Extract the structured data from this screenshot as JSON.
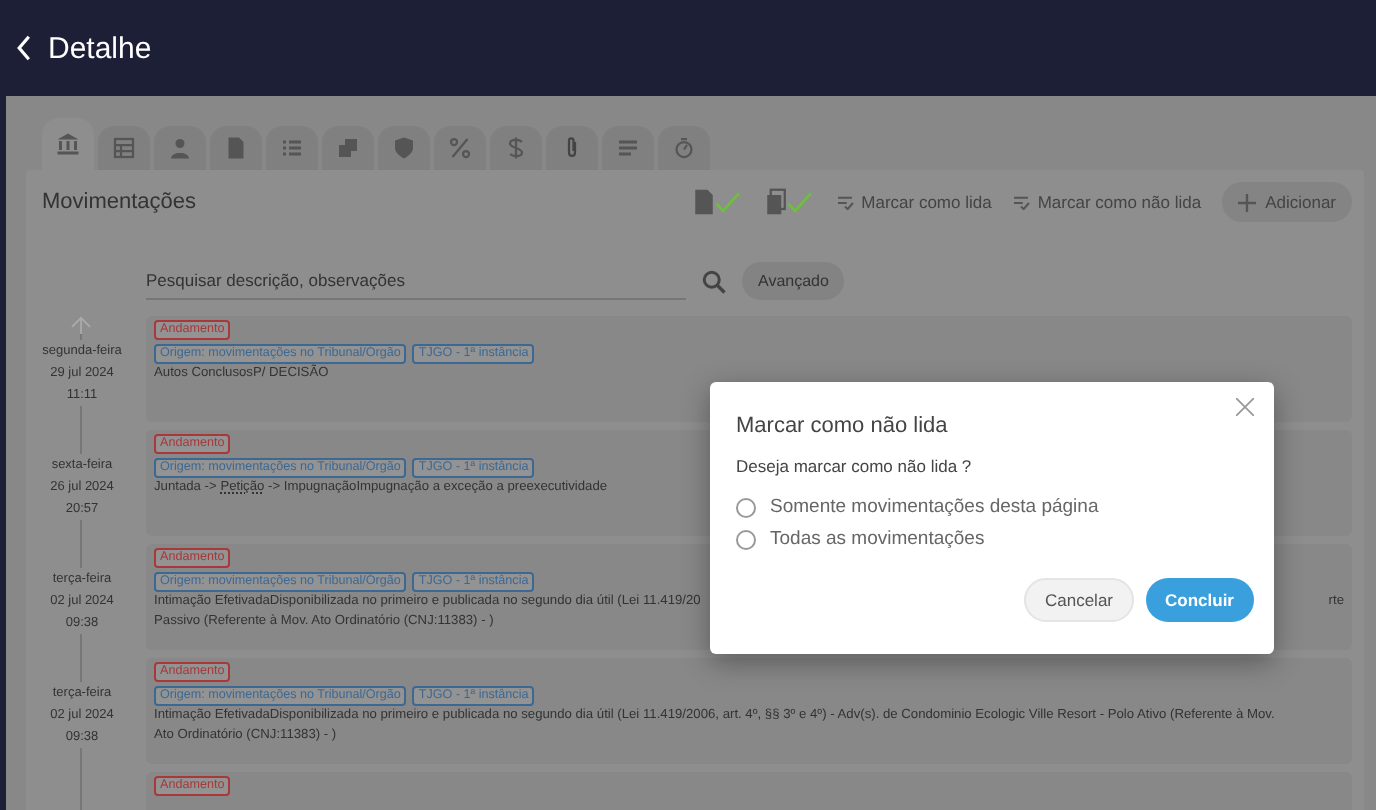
{
  "header": {
    "title": "Detalhe"
  },
  "tabs": [
    {
      "kind": "bank",
      "selected": true
    },
    {
      "kind": "table",
      "selected": false
    },
    {
      "kind": "person",
      "selected": false
    },
    {
      "kind": "document",
      "selected": false
    },
    {
      "kind": "list",
      "selected": false
    },
    {
      "kind": "stack",
      "selected": false
    },
    {
      "kind": "shield",
      "selected": false
    },
    {
      "kind": "percent",
      "selected": false
    },
    {
      "kind": "dollar",
      "selected": false
    },
    {
      "kind": "clip",
      "selected": false
    },
    {
      "kind": "lines",
      "selected": false
    },
    {
      "kind": "timer",
      "selected": false
    }
  ],
  "panel": {
    "title": "Movimentações",
    "actions": [
      {
        "kind": "doc-check"
      },
      {
        "kind": "docs-check"
      },
      {
        "kind": "text",
        "label": "Marcar como lida"
      },
      {
        "kind": "text",
        "label": "Marcar como não lida"
      },
      {
        "kind": "add",
        "label": "Adicionar"
      }
    ]
  },
  "search": {
    "placeholder": "Pesquisar descrição, observações",
    "advanced": "Avançado"
  },
  "rows": [
    {
      "weekday": "segunda-feira",
      "date": "29 jul 2024",
      "time": "11:11",
      "tags": [
        {
          "label": "Andamento",
          "color": "#a8383a"
        },
        {
          "label": "Origem: movimentações no Tribunal/Órgão",
          "color": "#3c6894"
        },
        {
          "label": "TJGO - 1ª instância",
          "color": "#3c6894"
        }
      ],
      "lines": [
        [
          {
            "kind": "plain",
            "text": "Autos ConclusosP/ DECISÃO"
          }
        ]
      ]
    },
    {
      "weekday": "sexta-feira",
      "date": "26 jul 2024",
      "time": "20:57",
      "tags": [
        {
          "label": "Andamento",
          "color": "#a8383a"
        },
        {
          "label": "Origem: movimentações no Tribunal/Órgão",
          "color": "#3c6894"
        },
        {
          "label": "TJGO - 1ª instância",
          "color": "#3c6894"
        }
      ],
      "lines": [
        [
          {
            "kind": "plain",
            "text": "Juntada -> "
          },
          {
            "kind": "link",
            "text": "Petição"
          },
          {
            "kind": "plain",
            "text": " -> ImpugnaçãoImpugnação a exceção a preexecutividade"
          }
        ]
      ]
    },
    {
      "weekday": "terça-feira",
      "date": "02 jul 2024",
      "time": "09:38",
      "tags": [
        {
          "label": "Andamento",
          "color": "#a8383a"
        },
        {
          "label": "Origem: movimentações no Tribunal/Órgão",
          "color": "#3c6894"
        },
        {
          "label": "TJGO - 1ª instância",
          "color": "#3c6894"
        }
      ],
      "lines": [
        [
          {
            "kind": "plain",
            "text": "Intimação EfetivadaDisponibilizada no primeiro e publicada no segundo dia útil (Lei 11.419/20"
          },
          {
            "kind": "end",
            "text": "rte"
          }
        ],
        [
          {
            "kind": "plain",
            "text": "Passivo (Referente à Mov. Ato Ordinatório (CNJ:11383) - )"
          }
        ]
      ]
    },
    {
      "weekday": "terça-feira",
      "date": "02 jul 2024",
      "time": "09:38",
      "tags": [
        {
          "label": "Andamento",
          "color": "#a8383a"
        },
        {
          "label": "Origem: movimentações no Tribunal/Órgão",
          "color": "#3c6894"
        },
        {
          "label": "TJGO - 1ª instância",
          "color": "#3c6894"
        }
      ],
      "lines": [
        [
          {
            "kind": "plain",
            "text": "Intimação EfetivadaDisponibilizada no primeiro e publicada no segundo dia útil (Lei 11.419/2006, art. 4º, §§ 3º e 4º) - Adv(s). de Condominio Ecologic Ville Resort - Polo Ativo (Referente à Mov."
          }
        ],
        [
          {
            "kind": "plain",
            "text": "Ato Ordinatório (CNJ:11383) - )"
          }
        ]
      ]
    },
    {
      "tags": [
        {
          "label": "Andamento",
          "color": "#a8383a"
        }
      ],
      "lines": []
    }
  ],
  "dialog": {
    "title": "Marcar como não lida",
    "question": "Deseja marcar como não lida ?",
    "options": [
      {
        "label": "Somente movimentações desta página",
        "selected": false
      },
      {
        "label": "Todas as movimentações",
        "selected": false
      }
    ],
    "cancel": "Cancelar",
    "confirm": "Concluir"
  }
}
